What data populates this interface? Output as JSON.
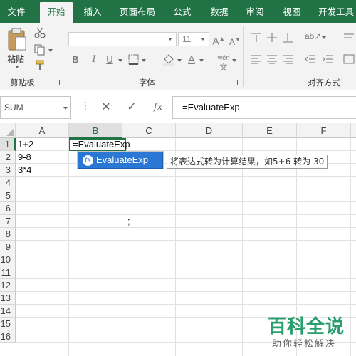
{
  "ribbon_tabs": [
    "文件",
    "开始",
    "插入",
    "页面布局",
    "公式",
    "数据",
    "审阅",
    "视图",
    "开发工具"
  ],
  "active_tab": "开始",
  "ribbon": {
    "clipboard": {
      "paste_label": "粘贴",
      "group_label": "剪贴板"
    },
    "font": {
      "size": "11",
      "group_label": "字体",
      "bold": "B",
      "italic": "I",
      "underline": "U",
      "phonetic": "wén"
    },
    "alignment": {
      "group_label": "对齐方式"
    }
  },
  "formula_bar": {
    "name_box": "SUM",
    "cancel_icon": "✕",
    "enter_icon": "✓",
    "fx_label": "fx",
    "formula": "=EvaluateExp"
  },
  "columns": [
    "A",
    "B",
    "C",
    "D",
    "E",
    "F"
  ],
  "rows": [
    "1",
    "2",
    "3",
    "4",
    "5",
    "6",
    "7",
    "8",
    "9",
    "10",
    "11",
    "12",
    "13",
    "14",
    "15",
    "16"
  ],
  "selected_column": "B",
  "selected_row": "1",
  "cells": {
    "A1": "1+2",
    "A2": "9-8",
    "A3": "3*4",
    "B1": "=EvaluateExp",
    "C7": ";"
  },
  "autocomplete": {
    "function_name": "EvaluateExp",
    "tooltip": "将表达式转为计算结果，如5+6 转为 30"
  },
  "watermark": {
    "title": "百科全说",
    "subtitle": "助你轻松解决"
  },
  "colors": {
    "excel_green": "#217346",
    "autocomplete_blue": "#2b78d4",
    "watermark_green": "#2a9d6f"
  }
}
